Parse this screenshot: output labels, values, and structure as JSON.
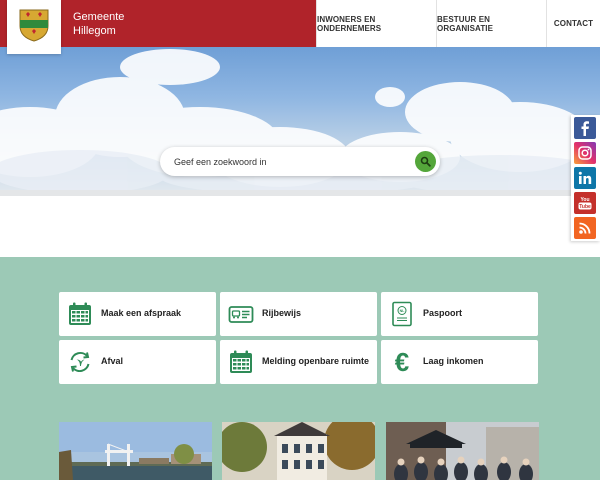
{
  "header": {
    "brand_line1": "Gemeente",
    "brand_line2": "Hillegom",
    "nav": [
      {
        "label": "INWONERS EN ONDERNEMERS"
      },
      {
        "label": "BESTUUR EN ORGANISATIE"
      },
      {
        "label": "CONTACT"
      }
    ]
  },
  "search": {
    "placeholder": "Geef een zoekwoord in"
  },
  "social": [
    "facebook-icon",
    "instagram-icon",
    "linkedin-icon",
    "youtube-icon",
    "rss-icon"
  ],
  "tiles": [
    {
      "label": "Maak een afspraak",
      "icon": "calendar-icon"
    },
    {
      "label": "Rijbewijs",
      "icon": "id-card-icon"
    },
    {
      "label": "Paspoort",
      "icon": "passport-icon"
    },
    {
      "label": "Afval",
      "icon": "recycle-icon"
    },
    {
      "label": "Melding openbare ruimte",
      "icon": "calendar-icon"
    },
    {
      "label": "Laag inkomen",
      "icon": "euro-icon"
    }
  ],
  "colors": {
    "brand": "#b0232a",
    "green": "#2e8b57",
    "teal_bg": "#9cc9b6",
    "search_button": "#54a63a"
  }
}
